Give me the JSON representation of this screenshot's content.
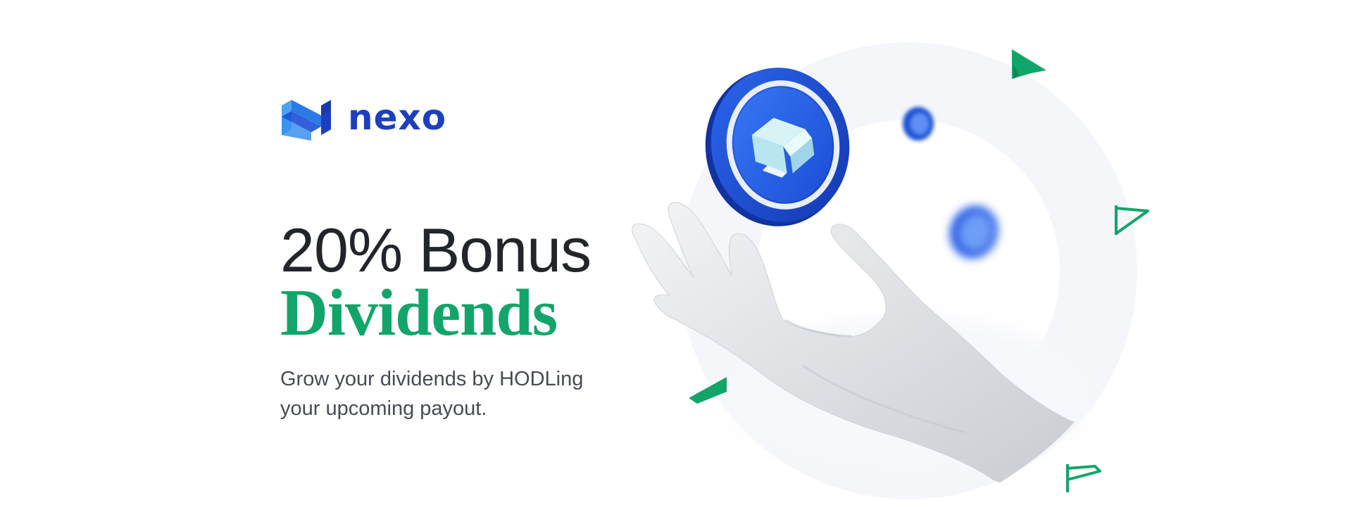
{
  "brand": {
    "name": "nexo",
    "logo_icon": "nexo-logo-icon",
    "color": "#1d3fbf"
  },
  "hero": {
    "headline": "20% Bonus",
    "headline_accent": "Dividends",
    "subcopy_line1": "Grow your dividends by HODLing",
    "subcopy_line2": "your upcoming payout."
  },
  "colors": {
    "accent_green": "#12a56a",
    "text_dark": "#22262b",
    "coin_blue": "#1c52d6"
  },
  "illustration": {
    "items": [
      "hand-illustration",
      "nexo-coin-icon",
      "blurred-coin-icon",
      "green-flag-shapes"
    ]
  }
}
